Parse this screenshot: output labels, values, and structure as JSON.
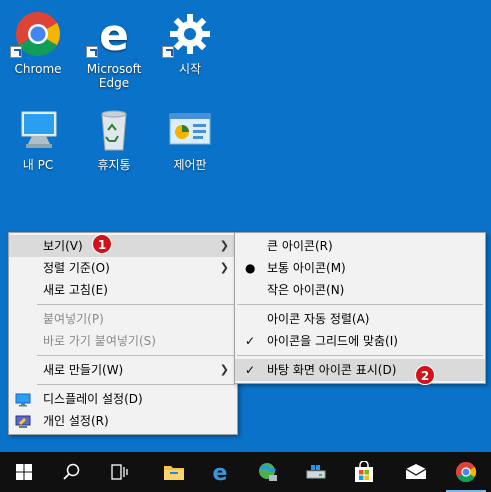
{
  "desktop": {
    "icons": [
      {
        "label": "Chrome"
      },
      {
        "label": "Microsoft Edge"
      },
      {
        "label": "시작"
      },
      {
        "label": "내 PC"
      },
      {
        "label": "휴지통"
      },
      {
        "label": "제어판"
      }
    ]
  },
  "context_menu": {
    "items": {
      "view": "보기(V)",
      "sort": "정렬 기준(O)",
      "refresh": "새로 고침(E)",
      "paste": "붙여넣기(P)",
      "paste_shortcut": "바로 가기 붙여넣기(S)",
      "new": "새로 만들기(W)",
      "display_settings": "디스플레이 설정(D)",
      "personalize": "개인 설정(R)"
    },
    "badge": "1"
  },
  "submenu": {
    "items": {
      "large": "큰 아이콘(R)",
      "medium": "보통 아이콘(M)",
      "small": "작은 아이콘(N)",
      "auto_arrange": "아이콘 자동 정렬(A)",
      "align_grid": "아이콘을 그리드에 맞춤(I)",
      "show_icons": "바탕 화면 아이콘 표시(D)"
    },
    "badge": "2"
  },
  "colors": {
    "desktop_bg": "#0a73c9",
    "taskbar_bg": "#101010",
    "badge": "#d0121b"
  }
}
